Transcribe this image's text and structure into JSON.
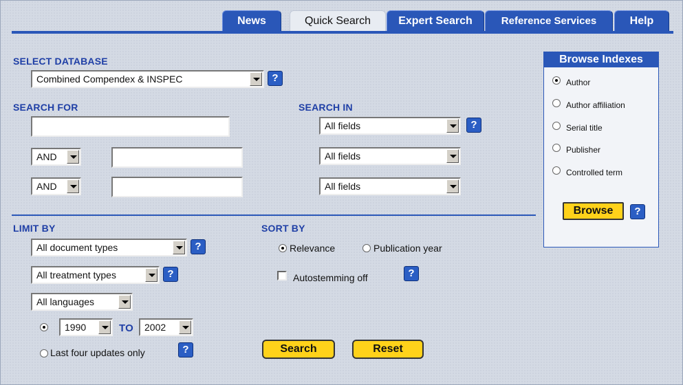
{
  "tabs": [
    {
      "label": "News",
      "active": false
    },
    {
      "label": "Quick Search",
      "active": true
    },
    {
      "label": "Expert Search",
      "active": false
    },
    {
      "label": "Reference Services",
      "active": false
    },
    {
      "label": "Help",
      "active": false
    }
  ],
  "select_database": {
    "label": "SELECT DATABASE",
    "value": "Combined Compendex & INSPEC"
  },
  "search_for": {
    "label": "SEARCH FOR",
    "rows": [
      {
        "value": "",
        "operator": null
      },
      {
        "value": "",
        "operator": "AND"
      },
      {
        "value": "",
        "operator": "AND"
      }
    ]
  },
  "search_in": {
    "label": "SEARCH IN",
    "rows": [
      "All fields",
      "All fields",
      "All fields"
    ]
  },
  "limit_by": {
    "label": "LIMIT BY",
    "document_types": "All document types",
    "treatment_types": "All treatment types",
    "languages": "All languages",
    "year_from": "1990",
    "to_label": "TO",
    "year_to": "2002",
    "last_four_label": "Last four updates only"
  },
  "sort_by": {
    "label": "SORT BY",
    "relevance": "Relevance",
    "publication_year": "Publication year",
    "autostemming": "Autostemming off"
  },
  "buttons": {
    "search": "Search",
    "reset": "Reset",
    "browse": "Browse"
  },
  "browse_indexes": {
    "title": "Browse Indexes",
    "options": [
      "Author",
      "Author affiliation",
      "Serial title",
      "Publisher",
      "Controlled term"
    ]
  },
  "help_glyph": "?",
  "colors": {
    "tab_blue": "#2a57b8",
    "label_blue": "#1f3fa6",
    "button_yellow": "#ffd21a"
  }
}
